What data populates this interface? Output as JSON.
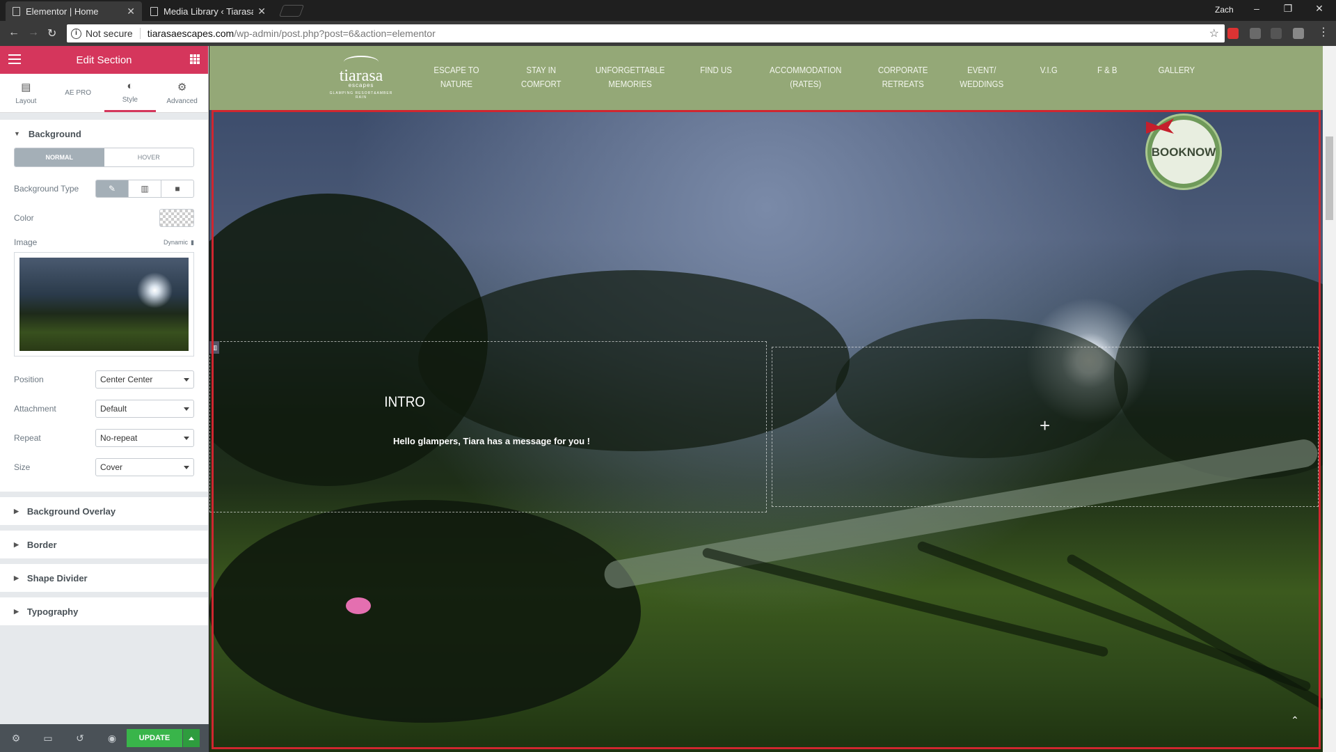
{
  "browser": {
    "tabs": [
      {
        "title": "Elementor | Home",
        "active": true
      },
      {
        "title": "Media Library ‹ Tiarasa E",
        "active": false
      }
    ],
    "user": "Zach",
    "security": "Not secure",
    "url_domain": "tiarasaescapes.com",
    "url_path": "/wp-admin/post.php?post=6&action=elementor"
  },
  "panel": {
    "title": "Edit Section",
    "tabs": [
      "Layout",
      "AE PRO",
      "Style",
      "Advanced"
    ],
    "active_tab": "Style",
    "background": {
      "heading": "Background",
      "state_tabs": [
        "NORMAL",
        "HOVER"
      ],
      "type_label": "Background Type",
      "color_label": "Color",
      "image_label": "Image",
      "dynamic_label": "Dynamic",
      "position_label": "Position",
      "position_value": "Center Center",
      "attachment_label": "Attachment",
      "attachment_value": "Default",
      "repeat_label": "Repeat",
      "repeat_value": "No-repeat",
      "size_label": "Size",
      "size_value": "Cover"
    },
    "sections": [
      "Background Overlay",
      "Border",
      "Shape Divider",
      "Typography"
    ],
    "update_label": "UPDATE",
    "accent_color": "#d5365c",
    "update_color": "#39b54a"
  },
  "site": {
    "logo_name": "tiarasa",
    "logo_sub": "escapes",
    "logo_tagline": "GLAMPING RESORT&AMBER RAIN",
    "menu": [
      [
        "ESCAPE TO",
        "NATURE"
      ],
      [
        "STAY IN",
        "COMFORT"
      ],
      [
        "UNFORGETTABLE",
        "MEMORIES"
      ],
      [
        "FIND US",
        ""
      ],
      [
        "ACCOMMODATION",
        "(RATES)"
      ],
      [
        "CORPORATE",
        "RETREATS"
      ],
      [
        "EVENT/",
        "WEDDINGS"
      ],
      [
        "V.I.G",
        ""
      ],
      [
        "F & B",
        ""
      ],
      [
        "GALLERY",
        ""
      ]
    ],
    "book_now": [
      "BOOK",
      "NOW"
    ],
    "intro_title": "INTRO",
    "intro_message": "Hello glampers, Tiara has a message for you !",
    "nav_color": "#94a877",
    "selection_color": "#d0262f"
  }
}
